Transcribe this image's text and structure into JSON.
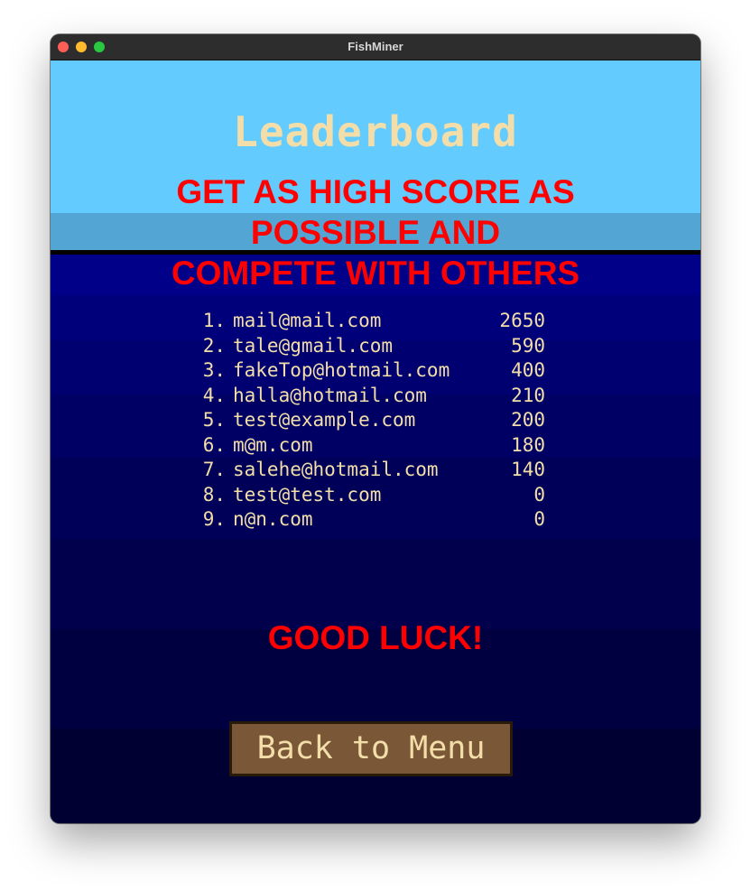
{
  "window": {
    "title": "FishMiner"
  },
  "leaderboard": {
    "heading": "Leaderboard",
    "promo_lines": [
      "GET AS HIGH SCORE AS",
      "POSSIBLE AND",
      "COMPETE WITH OTHERS"
    ],
    "entries": [
      {
        "rank": "1.",
        "email": "mail@mail.com",
        "score": "2650"
      },
      {
        "rank": "2.",
        "email": "tale@gmail.com",
        "score": "590"
      },
      {
        "rank": "3.",
        "email": "fakeTop@hotmail.com",
        "score": "400"
      },
      {
        "rank": "4.",
        "email": "halla@hotmail.com",
        "score": "210"
      },
      {
        "rank": "5.",
        "email": "test@example.com",
        "score": "200"
      },
      {
        "rank": "6.",
        "email": "m@m.com",
        "score": "180"
      },
      {
        "rank": "7.",
        "email": "salehe@hotmail.com",
        "score": "140"
      },
      {
        "rank": "8.",
        "email": "test@test.com",
        "score": "0"
      },
      {
        "rank": "9.",
        "email": "n@n.com",
        "score": "0"
      }
    ],
    "closing": "GOOD LUCK!",
    "back_button": "Back to Menu"
  },
  "colors": {
    "sky": "#63cbfe",
    "ocean_top": "#000088",
    "ocean_bottom": "#000033",
    "text_cream": "#f3deaa",
    "promo_red": "#ff0000",
    "button_brown": "#7a5737"
  }
}
